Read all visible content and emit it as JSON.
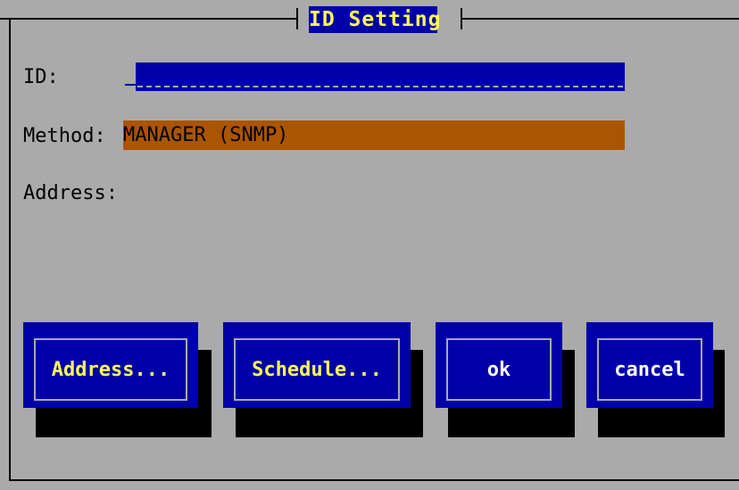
{
  "window": {
    "title": "ID Setting"
  },
  "form": {
    "id_label": "ID:",
    "id_value": "",
    "method_label": "Method:",
    "method_value": "MANAGER (SNMP)",
    "address_label": "Address:"
  },
  "buttons": {
    "address": "Address...",
    "schedule": "Schedule...",
    "ok": "ok",
    "cancel": "cancel"
  },
  "colors": {
    "background": "#aaaaaa",
    "dialog_blue": "#0000a8",
    "highlight_yellow": "#ffff55",
    "method_orange": "#aa5500"
  }
}
